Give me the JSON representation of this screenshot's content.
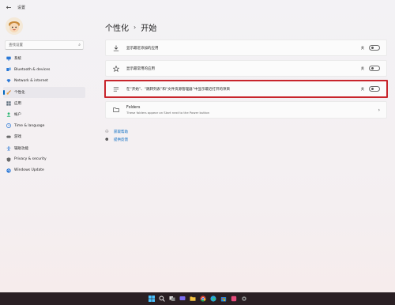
{
  "titlebar": {
    "back_icon": "arrow-left-icon",
    "title": "设置"
  },
  "sidebar": {
    "avatar_icon": "cartoon-avatar",
    "search": {
      "placeholder": "查找设置",
      "icon": "search-icon"
    },
    "items": [
      {
        "label": "系统",
        "icon": "monitor-icon",
        "color": "#2b78d6",
        "active": false
      },
      {
        "label": "Bluetooth & devices",
        "icon": "bluetooth-icon",
        "color": "#2b78d6",
        "active": false
      },
      {
        "label": "Network & internet",
        "icon": "wifi-icon",
        "color": "#2b78d6",
        "active": false
      },
      {
        "label": "个性化",
        "icon": "brush-icon",
        "color": "#d47a28",
        "active": true
      },
      {
        "label": "应用",
        "icon": "apps-icon",
        "color": "#5b6b7b",
        "active": false
      },
      {
        "label": "帐户",
        "icon": "account-icon",
        "color": "#2bb673",
        "active": false
      },
      {
        "label": "Time & language",
        "icon": "globe-clock-icon",
        "color": "#2b78d6",
        "active": false
      },
      {
        "label": "游戏",
        "icon": "gamepad-icon",
        "color": "#6b6b6b",
        "active": false
      },
      {
        "label": "辅助功能",
        "icon": "accessibility-icon",
        "color": "#2b78d6",
        "active": false
      },
      {
        "label": "Privacy & security",
        "icon": "shield-icon",
        "color": "#6b6b6b",
        "active": false
      },
      {
        "label": "Windows Update",
        "icon": "update-icon",
        "color": "#2b78d6",
        "active": false
      }
    ]
  },
  "main": {
    "breadcrumb": {
      "parent": "个性化",
      "separator": "›",
      "current": "开始"
    },
    "settings": [
      {
        "label": "显示最近添加的应用",
        "state": "关",
        "icon": "download-icon"
      },
      {
        "label": "显示最常用的应用",
        "state": "关",
        "icon": "star-icon"
      },
      {
        "label": "在“开始”、“跳转列表”和“文件资源管理器”中显示最近打开的项目",
        "state": "关",
        "icon": "list-icon"
      }
    ],
    "folders": {
      "title": "Folders",
      "subtitle": "These folders appear on Start next to the Power button",
      "icon": "folder-icon"
    },
    "links": [
      {
        "label": "获取帮助",
        "icon": "help-icon"
      },
      {
        "label": "提供反馈",
        "icon": "feedback-icon"
      }
    ]
  },
  "taskbar": {
    "icons": [
      "windows-start-icon",
      "search-icon",
      "task-view-icon",
      "chat-icon",
      "file-explorer-icon",
      "chrome-icon",
      "edge-icon",
      "store-icon",
      "app-icon",
      "settings-icon"
    ]
  },
  "colors": {
    "accent": "#0067c0",
    "highlight_border": "#c8252c",
    "taskbar": "#2a1f23"
  }
}
